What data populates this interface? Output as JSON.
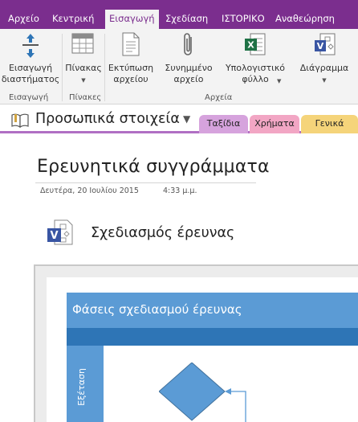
{
  "tabs": [
    "Αρχείο",
    "Κεντρική",
    "Εισαγωγή",
    "Σχεδίαση",
    "ΙΣΤΟΡΙΚΟ",
    "Αναθεώρηση"
  ],
  "ribbon": {
    "insert_space": {
      "line1": "Εισαγωγή",
      "line2": "διαστήματος"
    },
    "table": {
      "label": "Πίνακας"
    },
    "printout": {
      "line1": "Εκτύπωση",
      "line2": "αρχείου"
    },
    "attach": {
      "line1": "Συνημμένο",
      "line2": "αρχείο"
    },
    "spreadsheet": {
      "line1": "Υπολογιστικό",
      "line2": "φύλλο"
    },
    "diagram": {
      "label": "Διάγραμμα"
    },
    "groups": {
      "insert": "Εισαγωγή",
      "tables": "Πίνακες",
      "files": "Αρχεία"
    }
  },
  "notebook": {
    "name": "Προσωπικά στοιχεία",
    "sections": [
      {
        "label": "Ταξίδια",
        "color": "#d6a3dd"
      },
      {
        "label": "Χρήματα",
        "color": "#f2a6c4"
      },
      {
        "label": "Γενικά",
        "color": "#f5d47a"
      }
    ]
  },
  "page": {
    "title": "Ερευνητικά συγγράμματα",
    "date": "Δευτέρα, 20 Ιουλίου 2015",
    "time": "4:33 μ.μ.",
    "file_label": "Σχεδιασμός έρευνας",
    "diagram_header": "Φάσεις σχεδιασμού έρευνας",
    "lane_label": "Εξέταση"
  },
  "colors": {
    "accent": "#7b2e8e",
    "ribbon_bg": "#f3f3f3",
    "diagram_light": "#5b9bd5",
    "diagram_dark": "#2e75b6"
  }
}
